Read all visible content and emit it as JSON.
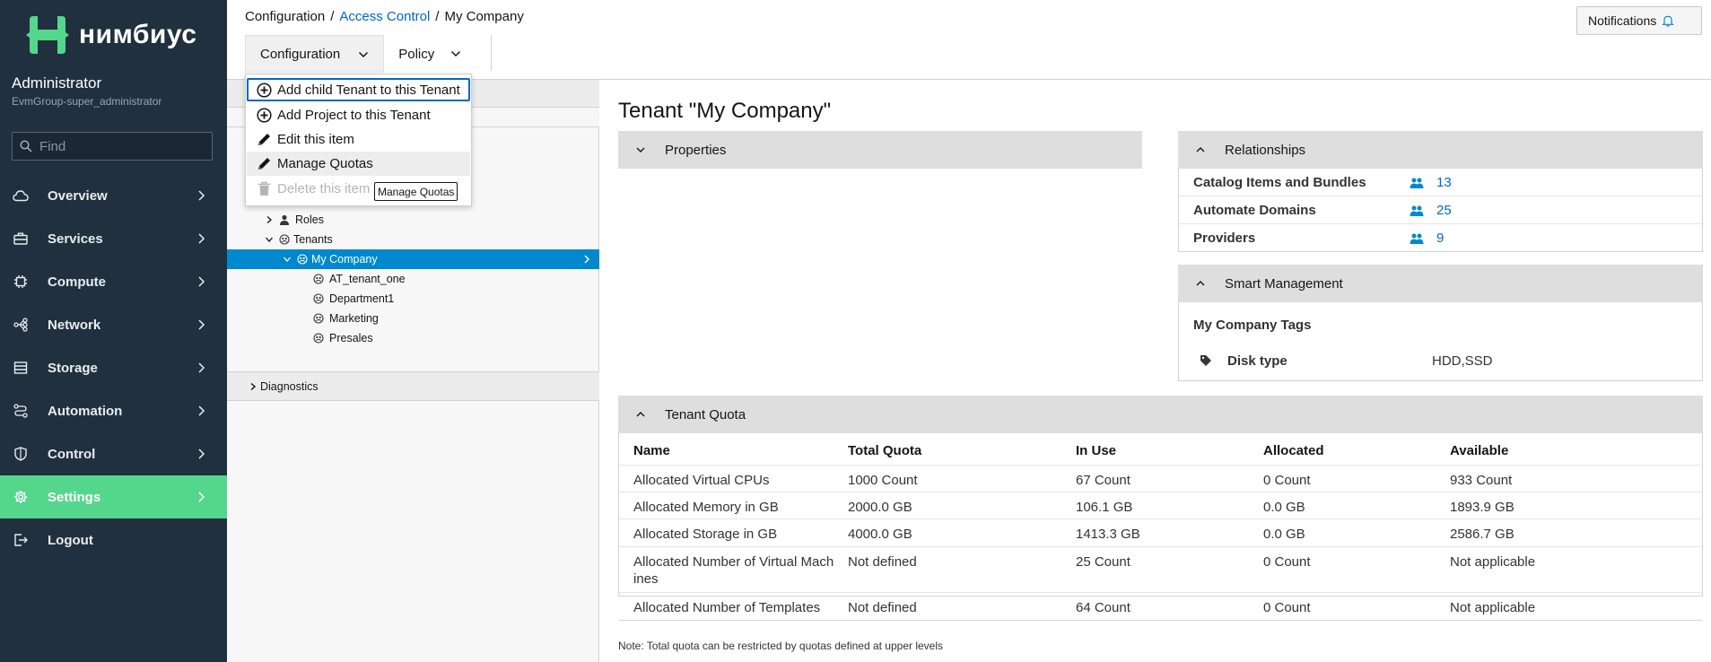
{
  "brand": {
    "name": "нимбиус"
  },
  "user": {
    "name": "Administrator",
    "group": "EvmGroup-super_administrator"
  },
  "search": {
    "placeholder": "Find"
  },
  "nav": {
    "items": [
      {
        "label": "Overview",
        "icon": "cloud-icon"
      },
      {
        "label": "Services",
        "icon": "briefcase-icon"
      },
      {
        "label": "Compute",
        "icon": "cpu-icon"
      },
      {
        "label": "Network",
        "icon": "network-icon"
      },
      {
        "label": "Storage",
        "icon": "database-icon"
      },
      {
        "label": "Automation",
        "icon": "automation-icon"
      },
      {
        "label": "Control",
        "icon": "shield-icon"
      },
      {
        "label": "Settings",
        "icon": "gear-icon",
        "active": true
      },
      {
        "label": "Logout",
        "icon": "logout-icon"
      }
    ]
  },
  "breadcrumb": {
    "root": "Configuration",
    "middle": "Access Control",
    "current": "My Company",
    "separator": "/"
  },
  "notifications": {
    "label": "Notifications"
  },
  "toolbar": {
    "configuration": "Configuration",
    "policy": "Policy"
  },
  "dropdown": {
    "items": [
      {
        "label": "Add child Tenant to this Tenant",
        "icon": "plus-circle-icon"
      },
      {
        "label": "Add Project to this Tenant",
        "icon": "plus-circle-icon"
      },
      {
        "label": "Edit this item",
        "icon": "pencil-icon"
      },
      {
        "label": "Manage Quotas",
        "icon": "pencil-icon"
      },
      {
        "label": "Delete this item",
        "icon": "trash-icon",
        "disabled": true
      }
    ],
    "tooltip": "Manage Quotas"
  },
  "tree": {
    "roles": "Roles",
    "tenants": "Tenants",
    "selected": "My Company",
    "children": [
      "AT_tenant_one",
      "Department1",
      "Marketing",
      "Presales"
    ],
    "diagnostics": "Diagnostics"
  },
  "page": {
    "title": "Tenant \"My Company\""
  },
  "properties": {
    "title": "Properties"
  },
  "relationships": {
    "title": "Relationships",
    "rows": [
      {
        "label": "Catalog Items and Bundles",
        "count": "13"
      },
      {
        "label": "Automate Domains",
        "count": "25"
      },
      {
        "label": "Providers",
        "count": "9"
      }
    ]
  },
  "smart_management": {
    "title": "Smart Management",
    "tags_title": "My Company Tags",
    "tag_label": "Disk type",
    "tag_value": "HDD,SSD"
  },
  "quota": {
    "title": "Tenant Quota",
    "headers": [
      "Name",
      "Total Quota",
      "In Use",
      "Allocated",
      "Available"
    ],
    "rows": [
      [
        "Allocated Virtual CPUs",
        "1000 Count",
        "67 Count",
        "0 Count",
        "933 Count"
      ],
      [
        "Allocated Memory in GB",
        "2000.0 GB",
        "106.1 GB",
        "0.0 GB",
        "1893.9 GB"
      ],
      [
        "Allocated Storage in GB",
        "4000.0 GB",
        "1413.3 GB",
        "0.0 GB",
        "2586.7 GB"
      ],
      [
        "Allocated Number of Virtual Mach ines",
        "Not defined",
        "25 Count",
        "0 Count",
        "Not applicable"
      ],
      [
        "Allocated Number of Templates",
        "Not defined",
        "64 Count",
        "0 Count",
        "Not applicable"
      ]
    ],
    "note": "Note: Total quota can be restricted by quotas defined at upper levels"
  },
  "colors": {
    "sidebar": "#21303f",
    "active": "#54d68d",
    "link": "#0066cc",
    "selected": "#0088ce"
  }
}
